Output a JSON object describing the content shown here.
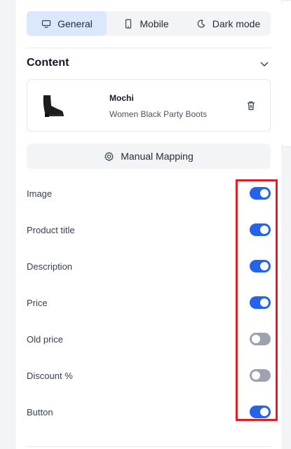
{
  "tabs": [
    {
      "label": "General",
      "icon": "desktop-icon",
      "active": true
    },
    {
      "label": "Mobile",
      "icon": "mobile-icon",
      "active": false
    },
    {
      "label": "Dark mode",
      "icon": "moon-icon",
      "active": false
    }
  ],
  "content": {
    "title": "Content",
    "product": {
      "name": "Mochi",
      "description": "Women Black Party Boots"
    },
    "mapping_label": "Manual Mapping"
  },
  "toggles": [
    {
      "label": "Image",
      "on": true
    },
    {
      "label": "Product title",
      "on": true
    },
    {
      "label": "Description",
      "on": true
    },
    {
      "label": "Price",
      "on": true
    },
    {
      "label": "Old price",
      "on": false
    },
    {
      "label": "Discount %",
      "on": false
    },
    {
      "label": "Button",
      "on": true
    }
  ],
  "colors": {
    "accent": "#2563eb",
    "toggle_off": "#9ca3af",
    "active_tab": "#dbe7fd",
    "highlight": "#e11d23"
  }
}
